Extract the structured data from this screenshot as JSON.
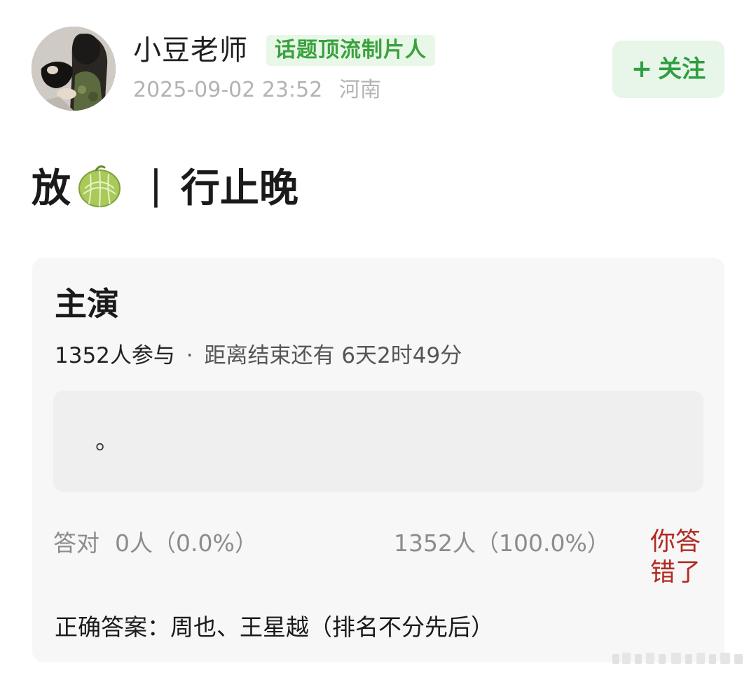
{
  "author": {
    "name": "小豆老师",
    "badge": "话题顶流制片人",
    "timestamp": "2025-09-02 23:52",
    "location": "河南",
    "follow_label": "关注",
    "follow_plus": "+"
  },
  "post": {
    "title_prefix": "放",
    "emoji": "melon-emoji",
    "separator": "|",
    "title_suffix": "行止晚"
  },
  "quiz": {
    "heading": "主演",
    "participants": "1352人参与",
    "dot": "·",
    "countdown": "距离结束还有 6天2时49分",
    "option_text": "。",
    "correct_label": "答对",
    "correct_count": "0人（0.0%）",
    "wrong_count": "1352人（100.0%）",
    "wrong_tag": "你答错了",
    "answer": "正确答案：周也、王星越（排名不分先后）"
  },
  "colors": {
    "accent_green": "#3aa23d",
    "badge_bg": "#e8f7e8",
    "wrong_red": "#b22a22",
    "card_bg": "#f7f7f7"
  }
}
